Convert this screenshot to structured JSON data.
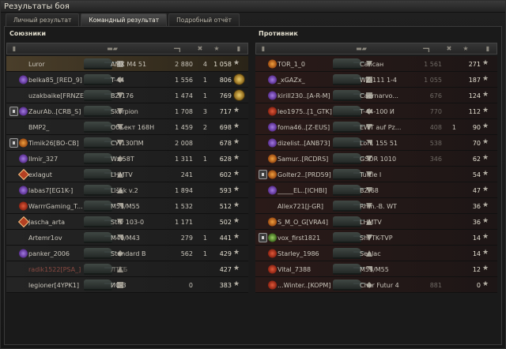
{
  "window": {
    "title": "Результаты боя"
  },
  "tabs": [
    {
      "label": "Личный результат",
      "active": false
    },
    {
      "label": "Командный результат",
      "active": true
    },
    {
      "label": "Подробный отчёт",
      "active": false
    }
  ],
  "allies": {
    "title": "Союзники",
    "rows": [
      {
        "name": "Luror",
        "vehicle": "AMX M4 51",
        "damage": "2 880",
        "kills": "4",
        "xp": "1 058",
        "platoon": false,
        "clan": "",
        "type": "heavy",
        "me": true,
        "medal": false,
        "dead": false
      },
      {
        "name": "belka85_[RED_9]",
        "vehicle": "T-44",
        "damage": "1 556",
        "kills": "1",
        "xp": "806",
        "platoon": false,
        "clan": "purple",
        "type": "medium",
        "me": false,
        "medal": true,
        "dead": false
      },
      {
        "name": "uzakbaike[FRNZE]",
        "vehicle": "BZ-176",
        "damage": "1 474",
        "kills": "1",
        "xp": "769",
        "platoon": false,
        "clan": "",
        "type": "td",
        "me": false,
        "medal": true,
        "dead": false
      },
      {
        "name": "ZaurAb..[CRB_S]",
        "vehicle": "Skorpion",
        "damage": "1 708",
        "kills": "3",
        "xp": "717",
        "platoon": true,
        "clan": "purple",
        "type": "td",
        "me": false,
        "medal": false,
        "dead": false
      },
      {
        "name": "BMP2_",
        "vehicle": "Объект 168Н",
        "damage": "1 459",
        "kills": "2",
        "xp": "698",
        "platoon": false,
        "clan": "",
        "type": "td",
        "me": false,
        "medal": false,
        "dead": false
      },
      {
        "name": "Timik26[BO-CB]",
        "vehicle": "СУ-130ПМ",
        "damage": "2 008",
        "kills": "",
        "xp": "678",
        "platoon": true,
        "clan": "orange",
        "type": "td",
        "me": false,
        "medal": false,
        "dead": false
      },
      {
        "name": "Ilmir_327",
        "vehicle": "Wz.58T",
        "damage": "1 311",
        "kills": "1",
        "xp": "628",
        "platoon": false,
        "clan": "purple",
        "type": "medium",
        "me": false,
        "medal": false,
        "dead": false
      },
      {
        "name": "exlagut",
        "vehicle": "LHMTV",
        "damage": "241",
        "kills": "",
        "xp": "602",
        "platoon": false,
        "clan": "diamond",
        "type": "light",
        "me": false,
        "medal": false,
        "dead": false
      },
      {
        "name": "labas7[EG1K-]",
        "vehicle": "Lišák v.2",
        "damage": "1 894",
        "kills": "",
        "xp": "593",
        "platoon": false,
        "clan": "purple",
        "type": "light",
        "me": false,
        "medal": false,
        "dead": false
      },
      {
        "name": "WarrrGaming_T...",
        "vehicle": "M53/M55",
        "damage": "1 532",
        "kills": "",
        "xp": "512",
        "platoon": false,
        "clan": "red",
        "type": "spg",
        "me": false,
        "medal": false,
        "dead": false
      },
      {
        "name": "Jascha_arta",
        "vehicle": "Strv 103-0",
        "damage": "1 171",
        "kills": "",
        "xp": "502",
        "platoon": false,
        "clan": "diamond",
        "type": "td",
        "me": false,
        "medal": false,
        "dead": false
      },
      {
        "name": "Artemr1ov",
        "vehicle": "M40/M43",
        "damage": "279",
        "kills": "1",
        "xp": "441",
        "platoon": false,
        "clan": "",
        "type": "spg",
        "me": false,
        "medal": false,
        "dead": false
      },
      {
        "name": "panker_2006",
        "vehicle": "Standard B",
        "damage": "562",
        "kills": "1",
        "xp": "429",
        "platoon": false,
        "clan": "purple",
        "type": "medium",
        "me": false,
        "medal": false,
        "dead": false
      },
      {
        "name": "radik1522[PSA_]",
        "vehicle": "ЛТТБ",
        "damage": "",
        "kills": "",
        "xp": "427",
        "platoon": false,
        "clan": "",
        "type": "light",
        "me": false,
        "medal": false,
        "dead": true
      },
      {
        "name": "legioner[4YPK1]",
        "vehicle": "ИС-3",
        "damage": "0",
        "kills": "",
        "xp": "383",
        "platoon": false,
        "clan": "",
        "type": "heavy",
        "me": false,
        "medal": false,
        "dead": false
      }
    ]
  },
  "enemies": {
    "title": "Противник",
    "rows": [
      {
        "name": "TOR_1_0",
        "vehicle": "Сапсан",
        "damage": "1 561",
        "kills": "",
        "xp": "271",
        "platoon": false,
        "clan": "orange",
        "type": "td",
        "dead": false
      },
      {
        "name": "_xGAZx_",
        "vehicle": "WZ-111 1-4",
        "damage": "1 055",
        "kills": "",
        "xp": "187",
        "platoon": false,
        "clan": "purple",
        "type": "heavy",
        "dead": false
      },
      {
        "name": "kirill230..[A-R-M]",
        "vehicle": "Caernarvo...",
        "damage": "676",
        "kills": "",
        "xp": "124",
        "platoon": false,
        "clan": "purple",
        "type": "heavy",
        "dead": false
      },
      {
        "name": "leo1975..[1_GTK]",
        "vehicle": "T-44-100 И",
        "damage": "770",
        "kills": "",
        "xp": "112",
        "platoon": false,
        "clan": "red",
        "type": "medium",
        "dead": false
      },
      {
        "name": "foma46..[Z-EUS]",
        "vehicle": "EWT auf Pz...",
        "damage": "408",
        "kills": "1",
        "xp": "90",
        "platoon": false,
        "clan": "purple",
        "type": "td",
        "dead": false
      },
      {
        "name": "dizelist..[ANB73]",
        "vehicle": "Lorr. 155 51",
        "damage": "538",
        "kills": "",
        "xp": "70",
        "platoon": false,
        "clan": "purple",
        "type": "spg",
        "dead": false
      },
      {
        "name": "Samur..[RCDRS]",
        "vehicle": "GSOR 1010",
        "damage": "346",
        "kills": "",
        "xp": "62",
        "platoon": false,
        "clan": "orange",
        "type": "td",
        "dead": false
      },
      {
        "name": "Golter2..[PRD59]",
        "vehicle": "Turtle I",
        "damage": "",
        "kills": "",
        "xp": "54",
        "platoon": true,
        "clan": "orange",
        "type": "td",
        "dead": false
      },
      {
        "name": "_____EL..[ICHBI]",
        "vehicle": "BZ-68",
        "damage": "",
        "kills": "",
        "xp": "47",
        "platoon": false,
        "clan": "purple",
        "type": "td",
        "dead": false
      },
      {
        "name": "Allex721[J-GR]",
        "vehicle": "Rhm.-B. WT",
        "damage": "",
        "kills": "",
        "xp": "36",
        "platoon": false,
        "clan": "",
        "type": "td",
        "dead": false
      },
      {
        "name": "S_M_O_G[VRA4]",
        "vehicle": "LHMTV",
        "damage": "",
        "kills": "",
        "xp": "36",
        "platoon": false,
        "clan": "orange",
        "type": "light",
        "dead": false
      },
      {
        "name": "vox_first1821",
        "vehicle": "ShPTK-TVP",
        "damage": "",
        "kills": "",
        "xp": "14",
        "platoon": true,
        "clan": "green",
        "type": "td",
        "dead": false
      },
      {
        "name": "Starley_1986",
        "vehicle": "Senlac",
        "damage": "",
        "kills": "",
        "xp": "14",
        "platoon": false,
        "clan": "red",
        "type": "light",
        "dead": false
      },
      {
        "name": "Vital_7388",
        "vehicle": "M53/M55",
        "damage": "",
        "kills": "",
        "xp": "12",
        "platoon": false,
        "clan": "red",
        "type": "spg",
        "dead": false
      },
      {
        "name": "...Winter..[KOPM]",
        "vehicle": "Char Futur 4",
        "damage": "881",
        "kills": "",
        "xp": "0",
        "platoon": false,
        "clan": "red",
        "type": "medium",
        "dead": false
      }
    ]
  }
}
